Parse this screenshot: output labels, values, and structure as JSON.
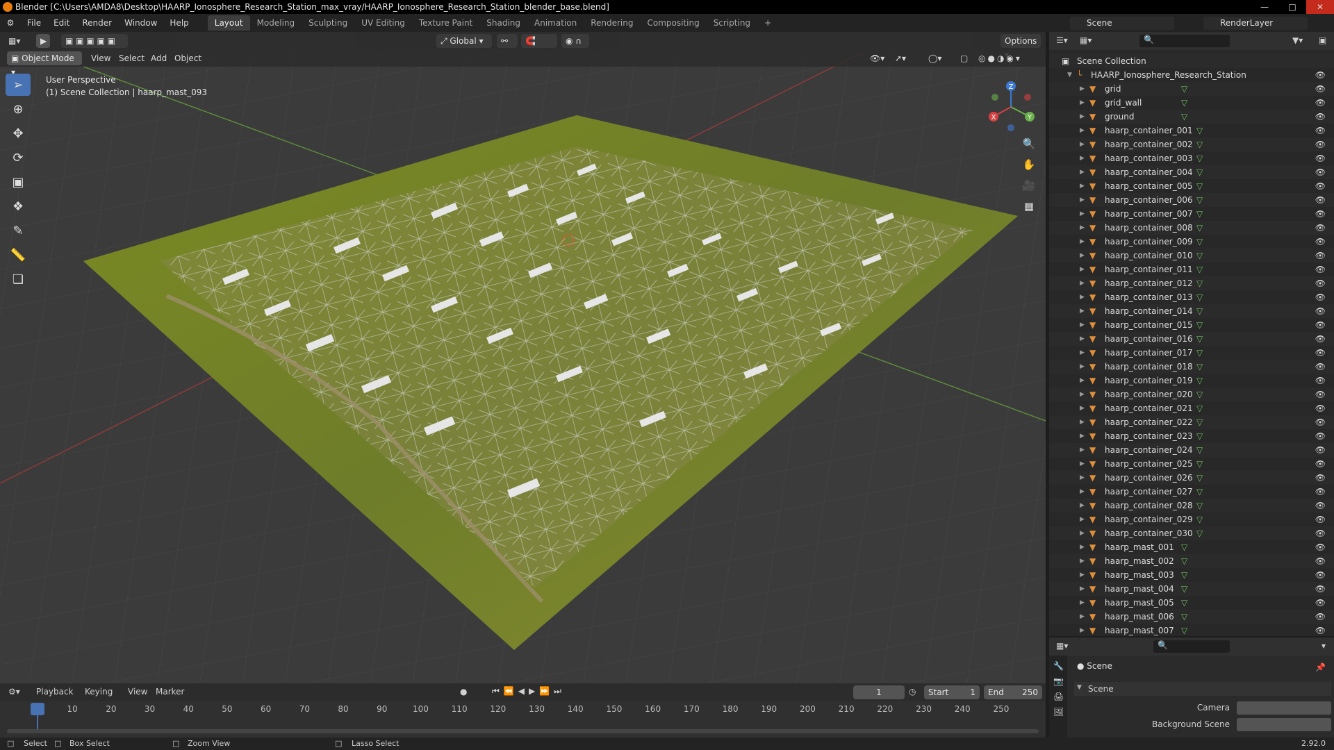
{
  "window": {
    "title": "Blender [C:\\Users\\AMDA8\\Desktop\\HAARP_Ionosphere_Research_Station_max_vray/HAARP_Ionosphere_Research_Station_blender_base.blend]"
  },
  "menu": [
    "File",
    "Edit",
    "Render",
    "Window",
    "Help"
  ],
  "workspaces": [
    "Layout",
    "Modeling",
    "Sculpting",
    "UV Editing",
    "Texture Paint",
    "Shading",
    "Animation",
    "Rendering",
    "Compositing",
    "Scripting"
  ],
  "active_workspace": "Layout",
  "header": {
    "scene": "Scene",
    "render_layer": "RenderLayer"
  },
  "toolbar": {
    "orientation": "Global",
    "options": "Options"
  },
  "viewport_header": {
    "mode": "Object Mode",
    "menus": [
      "View",
      "Select",
      "Add",
      "Object"
    ]
  },
  "overlay": {
    "perspective": "User Perspective",
    "collection_info": "(1) Scene Collection | haarp_mast_093"
  },
  "gizmo": {
    "x": "X",
    "y": "Y",
    "z": "Z"
  },
  "outliner": {
    "root": "Scene Collection",
    "collection": "HAARP_Ionosphere_Research_Station",
    "items": [
      "grid",
      "grid_wall",
      "ground",
      "haarp_container_001",
      "haarp_container_002",
      "haarp_container_003",
      "haarp_container_004",
      "haarp_container_005",
      "haarp_container_006",
      "haarp_container_007",
      "haarp_container_008",
      "haarp_container_009",
      "haarp_container_010",
      "haarp_container_011",
      "haarp_container_012",
      "haarp_container_013",
      "haarp_container_014",
      "haarp_container_015",
      "haarp_container_016",
      "haarp_container_017",
      "haarp_container_018",
      "haarp_container_019",
      "haarp_container_020",
      "haarp_container_021",
      "haarp_container_022",
      "haarp_container_023",
      "haarp_container_024",
      "haarp_container_025",
      "haarp_container_026",
      "haarp_container_027",
      "haarp_container_028",
      "haarp_container_029",
      "haarp_container_030",
      "haarp_mast_001",
      "haarp_mast_002",
      "haarp_mast_003",
      "haarp_mast_004",
      "haarp_mast_005",
      "haarp_mast_006",
      "haarp_mast_007"
    ]
  },
  "properties": {
    "context": "Scene",
    "panel": "Scene",
    "camera_label": "Camera",
    "background_label": "Background Scene"
  },
  "timeline": {
    "menus": [
      "Playback",
      "Keying",
      "View",
      "Marker"
    ],
    "current_frame": "1",
    "start_label": "Start",
    "start": "1",
    "end_label": "End",
    "end": "250",
    "ticks": [
      "1",
      "10",
      "20",
      "30",
      "40",
      "50",
      "60",
      "70",
      "80",
      "90",
      "100",
      "110",
      "120",
      "130",
      "140",
      "150",
      "160",
      "170",
      "180",
      "190",
      "200",
      "210",
      "220",
      "230",
      "240",
      "250"
    ]
  },
  "status": {
    "select": "Select",
    "box_select": "Box Select",
    "zoom_view": "Zoom View",
    "lasso_select": "Lasso Select",
    "version": "2.92.0"
  },
  "colors": {
    "accent": "#4772b3",
    "object_icon": "#e08f3a",
    "mesh_icon": "#6fbf5f",
    "ground": "#7a8a2a"
  }
}
